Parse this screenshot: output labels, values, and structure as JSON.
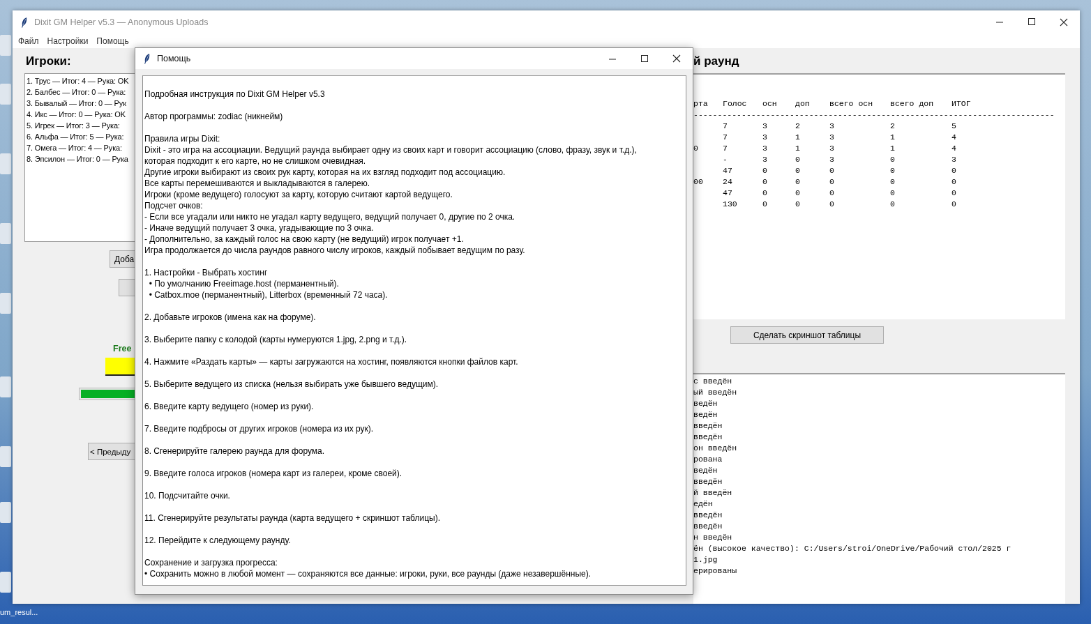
{
  "desktop": {
    "icon_label": "um_resul..."
  },
  "main_window": {
    "title": "Dixit GM Helper v5.3 — Anonymous Uploads",
    "active": false,
    "menu": [
      "Файл",
      "Настройки",
      "Помощь"
    ],
    "players_heading": "Игроки:",
    "players": [
      "1. Трус — Итог: 4 — Рука: OK",
      "2. Балбес — Итог: 0 — Рука:",
      "3. Бывалый — Итог: 0 — Рук",
      "4. Икс — Итог: 0 — Рука: OK",
      "5. Игрек — Итог: 3 — Рука:",
      "6. Альфа — Итог: 5 — Рука:",
      "7. Омега — Итог: 4 — Рука:",
      "8. Эпсилон — Итог: 0 — Рука"
    ],
    "add_button": "Доба",
    "hosting_label": "Free",
    "progress": {
      "level": 1
    },
    "prev_button": "< Предыду",
    "round_heading": "й раунд",
    "table": {
      "columns": [
        "рта",
        "Голос",
        "осн",
        "доп",
        "всего осн",
        "всего доп",
        "ИТОГ"
      ],
      "separator": "---------------------------------------------------------------------------",
      "rows": [
        {
          "cells": [
            "",
            "7",
            "3",
            "2",
            "3",
            "2",
            "5"
          ]
        },
        {
          "cells": [
            "",
            "7",
            "3",
            "1",
            "3",
            "1",
            "4"
          ]
        },
        {
          "cells": [
            "0",
            "7",
            "3",
            "1",
            "3",
            "1",
            "4"
          ]
        },
        {
          "cells": [
            "",
            "-",
            "3",
            "0",
            "3",
            "0",
            "3"
          ]
        },
        {
          "cells": [
            "",
            "47",
            "0",
            "0",
            "0",
            "0",
            "0"
          ]
        },
        {
          "cells": [
            "00",
            "24",
            "0",
            "0",
            "0",
            "0",
            "0"
          ]
        },
        {
          "cells": [
            "",
            "47",
            "0",
            "0",
            "0",
            "0",
            "0"
          ]
        },
        {
          "cells": [
            "",
            "130",
            "0",
            "0",
            "0",
            "0",
            "0"
          ]
        }
      ]
    },
    "screenshot_button": "Сделать скриншот таблицы",
    "log": [
      "с введён",
      "ый введён",
      "ведён",
      "ведён",
      "введён",
      "введён",
      "он введён",
      "рована",
      "ведён",
      "введён",
      "й введён",
      "едён",
      "введён",
      "введён",
      "н введён",
      "ён (высокое качество): C:/Users/stroi/OneDrive/Рабочий стол/2025 г",
      "1.jpg",
      "ерированы"
    ]
  },
  "help_dialog": {
    "title": "Помощь",
    "paragraphs": [
      [
        "Подробная инструкция по Dixit GM Helper v5.3"
      ],
      [
        "Автор программы: zodiac (никнейм)"
      ],
      [
        "Правила игры Dixit:",
        "Dixit - это игра на ассоциации. Ведущий раунда выбирает одну из своих карт и говорит ассоциацию (слово, фразу, звук и т.д.),",
        "которая подходит к его карте, но не слишком очевидная.",
        "Другие игроки выбирают из своих рук карту, которая на их взгляд подходит под ассоциацию.",
        "Все карты перемешиваются и выкладываются в галерею.",
        "Игроки (кроме ведущего) голосуют за карту, которую считают картой ведущего.",
        "Подсчет очков:",
        "- Если все угадали или никто не угадал карту ведущего, ведущий получает 0, другие по 2 очка.",
        "- Иначе ведущий получает 3 очка, угадывающие по 3 очка.",
        "- Дополнительно, за каждый голос на свою карту (не ведущий) игрок получает +1.",
        "Игра продолжается до числа раундов равного числу игроков, каждый побывает ведущим по разу."
      ],
      [
        "1. Настройки - Выбрать хостинг",
        "  • По умолчанию Freeimage.host (перманентный).",
        "  • Catbox.moe (перманентный), Litterbox (временный 72 часа)."
      ],
      [
        "2. Добавьте игроков (имена как на форуме)."
      ],
      [
        "3. Выберите папку с колодой (карты нумеруются 1.jpg, 2.png и т.д.)."
      ],
      [
        "4. Нажмите «Раздать карты» — карты загружаются на хостинг, появляются кнопки файлов карт."
      ],
      [
        "5. Выберите ведущего из списка (нельзя выбирать уже бывшего ведущим)."
      ],
      [
        "6. Введите карту ведущего (номер из руки)."
      ],
      [
        "7. Введите подбросы от других игроков (номера из их рук)."
      ],
      [
        "8. Сгенерируйте галерею раунда для форума."
      ],
      [
        "9. Введите голоса игроков (номера карт из галереи, кроме своей)."
      ],
      [
        "10. Подсчитайте очки."
      ],
      [
        "11. Сгенерируйте результаты раунда (карта ведущего + скриншот таблицы)."
      ],
      [
        "12. Перейдите к следующему раунду."
      ],
      [
        "Сохранение и загрузка прогресса:",
        "• Сохранить можно в любой момент — сохраняются все данные: игроки, руки, все раунды (даже незавершённые)."
      ]
    ]
  }
}
